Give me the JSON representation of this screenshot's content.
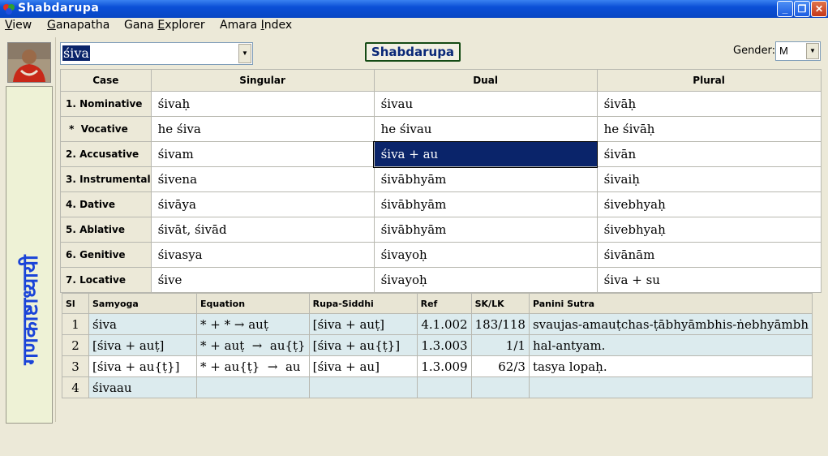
{
  "window": {
    "title": "Shabdarupa",
    "minimize": "_",
    "maximize": "❐",
    "close": "✕"
  },
  "menu": [
    {
      "prefix": "",
      "underline": "V",
      "rest": "iew"
    },
    {
      "prefix": "",
      "underline": "G",
      "rest": "anapatha"
    },
    {
      "prefix": "Gana ",
      "underline": "E",
      "rest": "xplorer"
    },
    {
      "prefix": "Amara ",
      "underline": "I",
      "rest": "ndex"
    }
  ],
  "left_panel": {
    "vertical_text": "गणकाष्टाध्यायी"
  },
  "search": {
    "value": "śiva"
  },
  "main_button": "Shabdarupa",
  "gender": {
    "label": "Gender:",
    "value": "M"
  },
  "declension": {
    "headers": [
      "Case",
      "Singular",
      "Dual",
      "Plural"
    ],
    "rows": [
      [
        "1. Nominative",
        "śivaḥ",
        "śivau",
        "śivāḥ"
      ],
      [
        " *  Vocative",
        "he śiva",
        "he śivau",
        "he śivāḥ"
      ],
      [
        "2. Accusative",
        "śivam",
        "śiva + au",
        "śivān"
      ],
      [
        "3. Instrumental",
        "śivena",
        "śivābhyām",
        "śivaiḥ"
      ],
      [
        "4. Dative",
        "śivāya",
        "śivābhyām",
        "śivebhyaḥ"
      ],
      [
        "5. Ablative",
        "śivāt, śivād",
        "śivābhyām",
        "śivebhyaḥ"
      ],
      [
        "6. Genitive",
        "śivasya",
        "śivayoḥ",
        "śivānām"
      ],
      [
        "7. Locative",
        "śive",
        "śivayoḥ",
        "śiva + su"
      ]
    ],
    "selected": {
      "row": 2,
      "col": 2
    }
  },
  "derivation": {
    "headers": [
      "Sl",
      "Samyoga",
      "Equation",
      "Rupa-Siddhi",
      "Ref",
      "SK/LK",
      "Panini Sutra"
    ],
    "rows": [
      [
        "1",
        "śiva",
        "* + * → auṭ",
        "[śiva + auṭ]",
        "4.1.002",
        "183/118",
        "svaujas-amauṭchas-ṭābhyāmbhis-ṅebhyāmbh"
      ],
      [
        "2",
        "[śiva + auṭ]",
        "* + auṭ  →  au{ṭ}",
        "[śiva + au{ṭ}]",
        "1.3.003",
        "1/1",
        "hal-antyam."
      ],
      [
        "3",
        "[śiva + au{ṭ}]",
        "* + au{ṭ}  →  au",
        "[śiva + au]",
        "1.3.009",
        "62/3",
        "tasya lopaḥ."
      ],
      [
        "4",
        "śivaau",
        "",
        "",
        "",
        "",
        ""
      ]
    ]
  }
}
